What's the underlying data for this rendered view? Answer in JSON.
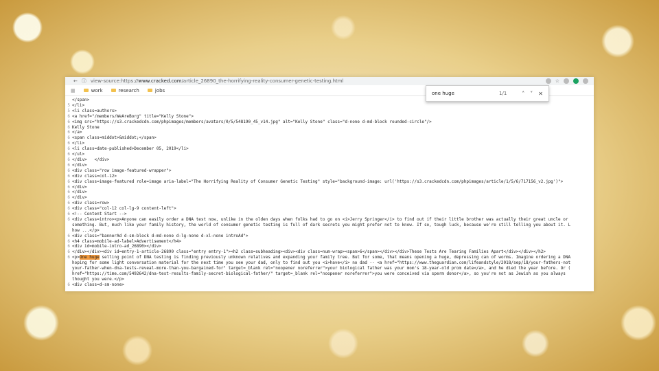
{
  "browser": {
    "url_prefix": "view-source:https://",
    "url_domain": "www.cracked.com",
    "url_path": "/article_26890_the-horrifying-reality-consumer-genetic-testing.html"
  },
  "bookmarks": [
    "work",
    "research",
    "jobs"
  ],
  "find": {
    "query": "one huge",
    "count": "1/1",
    "up": "˄",
    "down": "˅",
    "close": "✕"
  },
  "source": {
    "highlight": "One huge",
    "lines": [
      {
        "n": "",
        "t": "</span>"
      },
      {
        "n": "5",
        "t": "</li>"
      },
      {
        "n": "5",
        "t": "<li class=authors>"
      },
      {
        "n": "6",
        "t": "<a href=\"/members/WeAreBorg\" title=\"Kelly Stone\">"
      },
      {
        "n": "6",
        "t": "<img src=\"https://s3.crackedcdn.com/phpimages/members/avatars/0/5/548190_45_v14.jpg\" alt=\"Kelly Stone\" class=\"d-none d-md-block rounded-circle\"/>"
      },
      {
        "n": "6",
        "t": "Kelly Stone"
      },
      {
        "n": "6",
        "t": "</a>"
      },
      {
        "n": "6",
        "t": "<span class=middot>&middot;</span>"
      },
      {
        "n": "6",
        "t": "</li>"
      },
      {
        "n": "6",
        "t": "<li class=date-published>December 05, 2019</li>"
      },
      {
        "n": "6",
        "t": "</ul>"
      },
      {
        "n": "6",
        "t": "</div>   </div>"
      },
      {
        "n": "6",
        "t": "</div>"
      },
      {
        "n": "6",
        "t": "<div class=\"row image-featured-wrapper\">"
      },
      {
        "n": "6",
        "t": "<div class=col-12>"
      },
      {
        "n": "6",
        "t": "<div class=image-featured role=image aria-label=\"The Horrifying Reality of Consumer Genetic Testing\" style=\"background-image: url('https://s3.crackedcdn.com/phpimages/article/1/5/6/717156_v2.jpg')\">"
      },
      {
        "n": "6",
        "t": "</div>"
      },
      {
        "n": "6",
        "t": "</div>"
      },
      {
        "n": "6",
        "t": "</div>"
      },
      {
        "n": "6",
        "t": "<div class=row>"
      },
      {
        "n": "6",
        "t": "<div class=\"col-12 col-lg-9 content-left\">"
      },
      {
        "n": "6",
        "t": "<!-- Content Start -->"
      },
      {
        "n": "6",
        "t": "<div class=intro><p>Anyone can easily order a DNA test now, unlike in the olden days when folks had to go on <i>Jerry Springer</i> to find out if their little brother was actually their great uncle or"
      },
      {
        "n": "",
        "t": "something. But, much like your family history, the world of consumer genetic testing is full of dark secrets you might prefer not to know. If so, tough luck, because we're still telling you about it. L"
      },
      {
        "n": "",
        "t": "how ...</p>"
      },
      {
        "n": "6",
        "t": "<div class=\"bannerAd d-sm-block d-md-none d-lg-none d-xl-none introAd\">"
      },
      {
        "n": "6",
        "t": "<h4 class=mobile-ad-label>Advertisement</h4>"
      },
      {
        "n": "6",
        "t": "<div id=mobile-intro-ad_26890></div>"
      },
      {
        "n": "6",
        "t": "</div></div><div id=entry-1-article-26890 class=\"entry entry-1\"><h2 class=subheading><div><div class=num-wrap><span>6</span></div></div>These Tests Are Tearing Families Apart</div></div></h2>"
      },
      {
        "n": "6",
        "t": "<p>One huge selling point of DNA testing is finding previously unknown relatives and expanding your family tree. But for some, that means opening a huge, depressing can of worms. Imagine ordering a DNA"
      },
      {
        "n": "",
        "t": "hoping for some light conversation material for the next time you see your dad, only to find out you <i>have</i> no dad -- <a href=\"https://www.theguardian.com/lifeandstyle/2018/sep/18/your-fathers-not"
      },
      {
        "n": "",
        "t": "your-father-when-dna-tests-reveal-more-than-you-bargained-for\" target=_blank rel=\"noopener noreferrer\">your biological father was your mom's 18-year-old prom date</a>, and he died the year before. Or ("
      },
      {
        "n": "",
        "t": "href=\"https://time.com/5492642/dna-test-results-family-secret-biological-father/\" target=_blank rel=\"noopener noreferrer\">you were conceived via sperm donor</a>, so you're not as Jewish as you always"
      },
      {
        "n": "",
        "t": "thought you were.</p>"
      },
      {
        "n": "6",
        "t": "<div class=d-sm-none>"
      }
    ]
  }
}
